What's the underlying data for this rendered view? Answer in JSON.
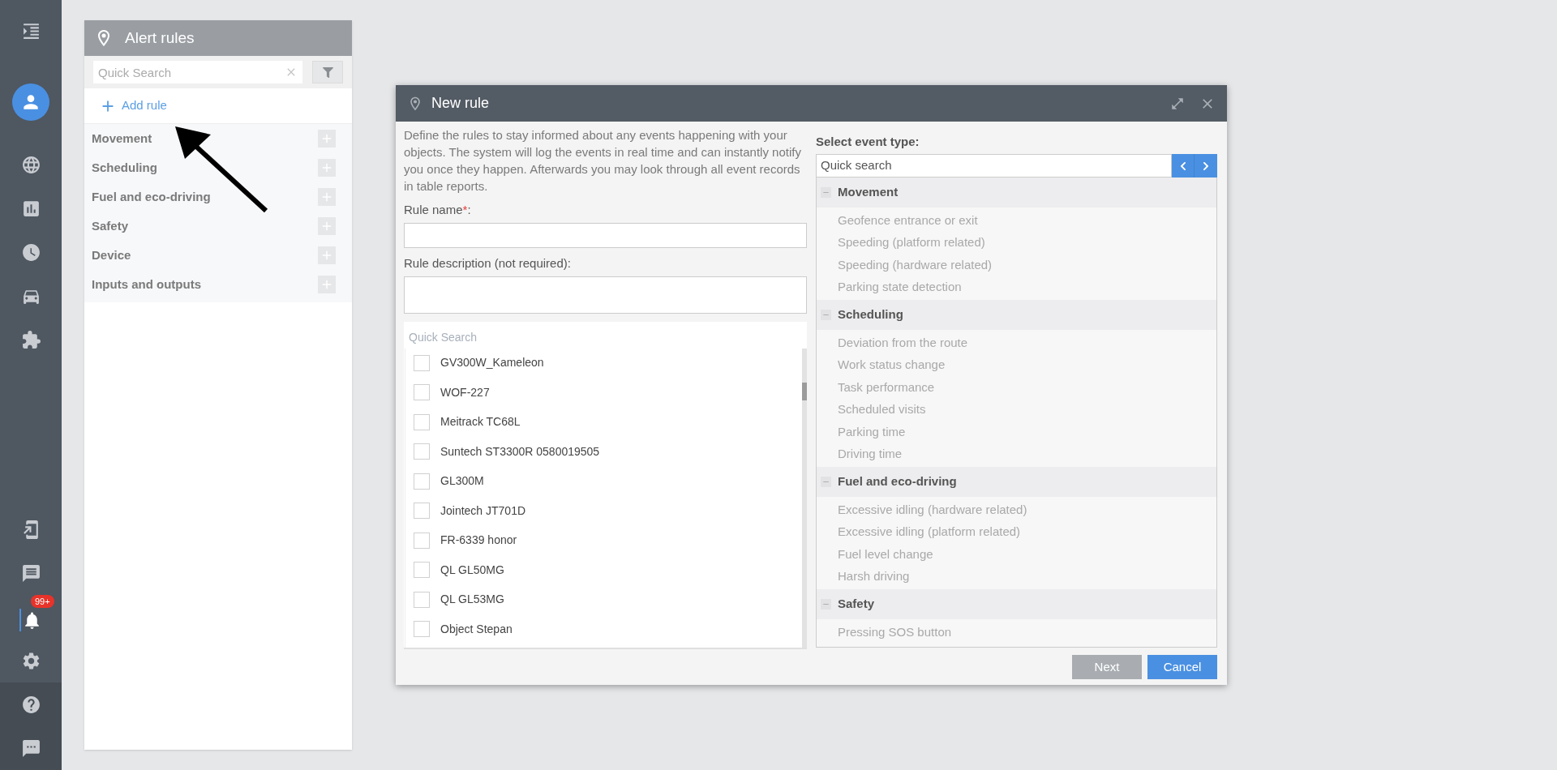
{
  "rail": {
    "items": [
      {
        "kind": "menu",
        "selected": false
      },
      {
        "kind": "avatar",
        "selected": false
      },
      {
        "kind": "globe",
        "selected": false
      },
      {
        "kind": "chart",
        "selected": false
      },
      {
        "kind": "clock",
        "selected": false
      },
      {
        "kind": "car",
        "selected": false
      },
      {
        "kind": "puzzle",
        "selected": false
      }
    ],
    "bottom_items": [
      {
        "kind": "device",
        "selected": false
      },
      {
        "kind": "message",
        "selected": false
      },
      {
        "kind": "bell",
        "selected": true,
        "badge": "99+"
      },
      {
        "kind": "gear",
        "selected": false
      },
      {
        "kind": "help",
        "selected": false
      },
      {
        "kind": "chat",
        "selected": false
      }
    ]
  },
  "panel": {
    "title": "Alert rules",
    "search": {
      "placeholder": "Quick Search"
    },
    "add_button": "Add rule",
    "categories": [
      {
        "label": "Movement"
      },
      {
        "label": "Scheduling"
      },
      {
        "label": "Fuel and eco-driving"
      },
      {
        "label": "Safety"
      },
      {
        "label": "Device"
      },
      {
        "label": "Inputs and outputs"
      }
    ]
  },
  "dialog": {
    "title": "New rule",
    "intro": "Define the rules to stay informed about any events happening with your objects. The system will log the events in real time and can instantly notify you once they happen. Afterwards you may look through all event records in table reports.",
    "name_label": {
      "text": "Rule name",
      "mark": "*",
      "suffix": ":"
    },
    "description_label": "Rule description (not required):",
    "objects": {
      "search": {
        "placeholder": "Quick Search"
      },
      "items": [
        {
          "label": "GV300W_Kameleon",
          "checked": false
        },
        {
          "label": "WOF-227",
          "checked": false
        },
        {
          "label": "Meitrack TC68L",
          "checked": false
        },
        {
          "label": "Suntech ST3300R 0580019505",
          "checked": false
        },
        {
          "label": "GL300M",
          "checked": false
        },
        {
          "label": "Jointech JT701D",
          "checked": false
        },
        {
          "label": "FR-6339 honor",
          "checked": false
        },
        {
          "label": "QL GL50MG",
          "checked": false
        },
        {
          "label": "QL GL53MG",
          "checked": false
        },
        {
          "label": "Object Stepan",
          "checked": false
        }
      ]
    },
    "event_type": {
      "heading": "Select event type:",
      "search": {
        "placeholder": "Quick search"
      },
      "groups": [
        {
          "label": "Movement",
          "expanded": true,
          "items": [
            {
              "label": "Geofence entrance or exit",
              "disabled": true
            },
            {
              "label": "Speeding (platform related)",
              "disabled": true
            },
            {
              "label": "Speeding (hardware related)",
              "disabled": true
            },
            {
              "label": "Parking state detection",
              "disabled": true
            }
          ]
        },
        {
          "label": "Scheduling",
          "expanded": true,
          "items": [
            {
              "label": "Deviation from the route",
              "disabled": true
            },
            {
              "label": "Work status change",
              "disabled": true
            },
            {
              "label": "Task performance",
              "disabled": true
            },
            {
              "label": "Scheduled visits",
              "disabled": true
            },
            {
              "label": "Parking time",
              "disabled": true
            },
            {
              "label": "Driving time",
              "disabled": true
            }
          ]
        },
        {
          "label": "Fuel and eco-driving",
          "expanded": true,
          "items": [
            {
              "label": "Excessive idling (hardware related)",
              "disabled": true
            },
            {
              "label": "Excessive idling (platform related)",
              "disabled": true
            },
            {
              "label": "Fuel level change",
              "disabled": true
            },
            {
              "label": "Harsh driving",
              "disabled": true
            }
          ]
        },
        {
          "label": "Safety",
          "expanded": true,
          "items": [
            {
              "label": "Pressing SOS button",
              "disabled": true
            }
          ]
        }
      ]
    },
    "buttons": [
      {
        "label": "Next",
        "kind": "secondary",
        "disabled": true
      },
      {
        "label": "Cancel",
        "kind": "primary",
        "disabled": false
      }
    ]
  }
}
